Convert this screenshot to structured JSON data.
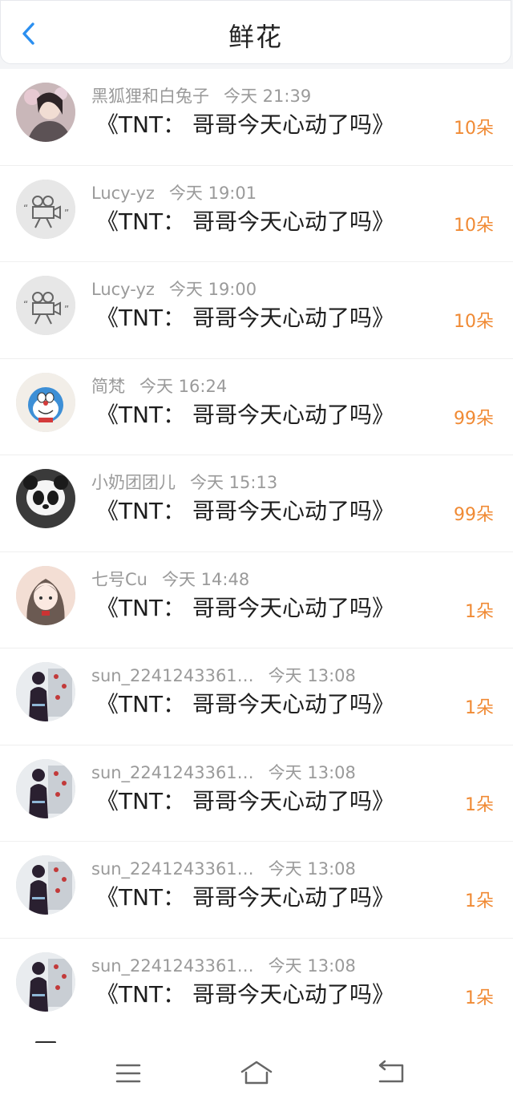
{
  "header": {
    "title": "鲜花",
    "back_icon": "chevron-left-icon",
    "accent_color": "#2b8ff0"
  },
  "records": [
    {
      "user": "黑狐狸和白兔子",
      "time": "今天 21:39",
      "gift": "《TNT：  哥哥今天心动了吗》",
      "count": "10朵",
      "avatar": "portrait-photo"
    },
    {
      "user": "Lucy-yz",
      "time": "今天 19:01",
      "gift": "《TNT：  哥哥今天心动了吗》",
      "count": "10朵",
      "avatar": "default-camera-avatar"
    },
    {
      "user": "Lucy-yz",
      "time": "今天 19:00",
      "gift": "《TNT：  哥哥今天心动了吗》",
      "count": "10朵",
      "avatar": "default-camera-avatar"
    },
    {
      "user": "简梵",
      "time": "今天 16:24",
      "gift": "《TNT：  哥哥今天心动了吗》",
      "count": "99朵",
      "avatar": "doraemon-avatar"
    },
    {
      "user": "小奶团团儿",
      "time": "今天 15:13",
      "gift": "《TNT：  哥哥今天心动了吗》",
      "count": "99朵",
      "avatar": "panda-avatar"
    },
    {
      "user": "七号Cu",
      "time": "今天 14:48",
      "gift": "《TNT：  哥哥今天心动了吗》",
      "count": "1朵",
      "avatar": "anime-girl-avatar"
    },
    {
      "user": "sun_2241243361…",
      "time": "今天 13:08",
      "gift": "《TNT：  哥哥今天心动了吗》",
      "count": "1朵",
      "avatar": "figure-photo-avatar"
    },
    {
      "user": "sun_2241243361…",
      "time": "今天 13:08",
      "gift": "《TNT：  哥哥今天心动了吗》",
      "count": "1朵",
      "avatar": "figure-photo-avatar"
    },
    {
      "user": "sun_2241243361…",
      "time": "今天 13:08",
      "gift": "《TNT：  哥哥今天心动了吗》",
      "count": "1朵",
      "avatar": "figure-photo-avatar"
    },
    {
      "user": "sun_2241243361…",
      "time": "今天 13:08",
      "gift": "《TNT：  哥哥今天心动了吗》",
      "count": "1朵",
      "avatar": "figure-photo-avatar"
    }
  ],
  "colors": {
    "count_color": "#f08a34",
    "meta_color": "#9a9a9a"
  },
  "navbar": {
    "icons": [
      "menu-icon",
      "home-icon",
      "back-icon"
    ]
  }
}
